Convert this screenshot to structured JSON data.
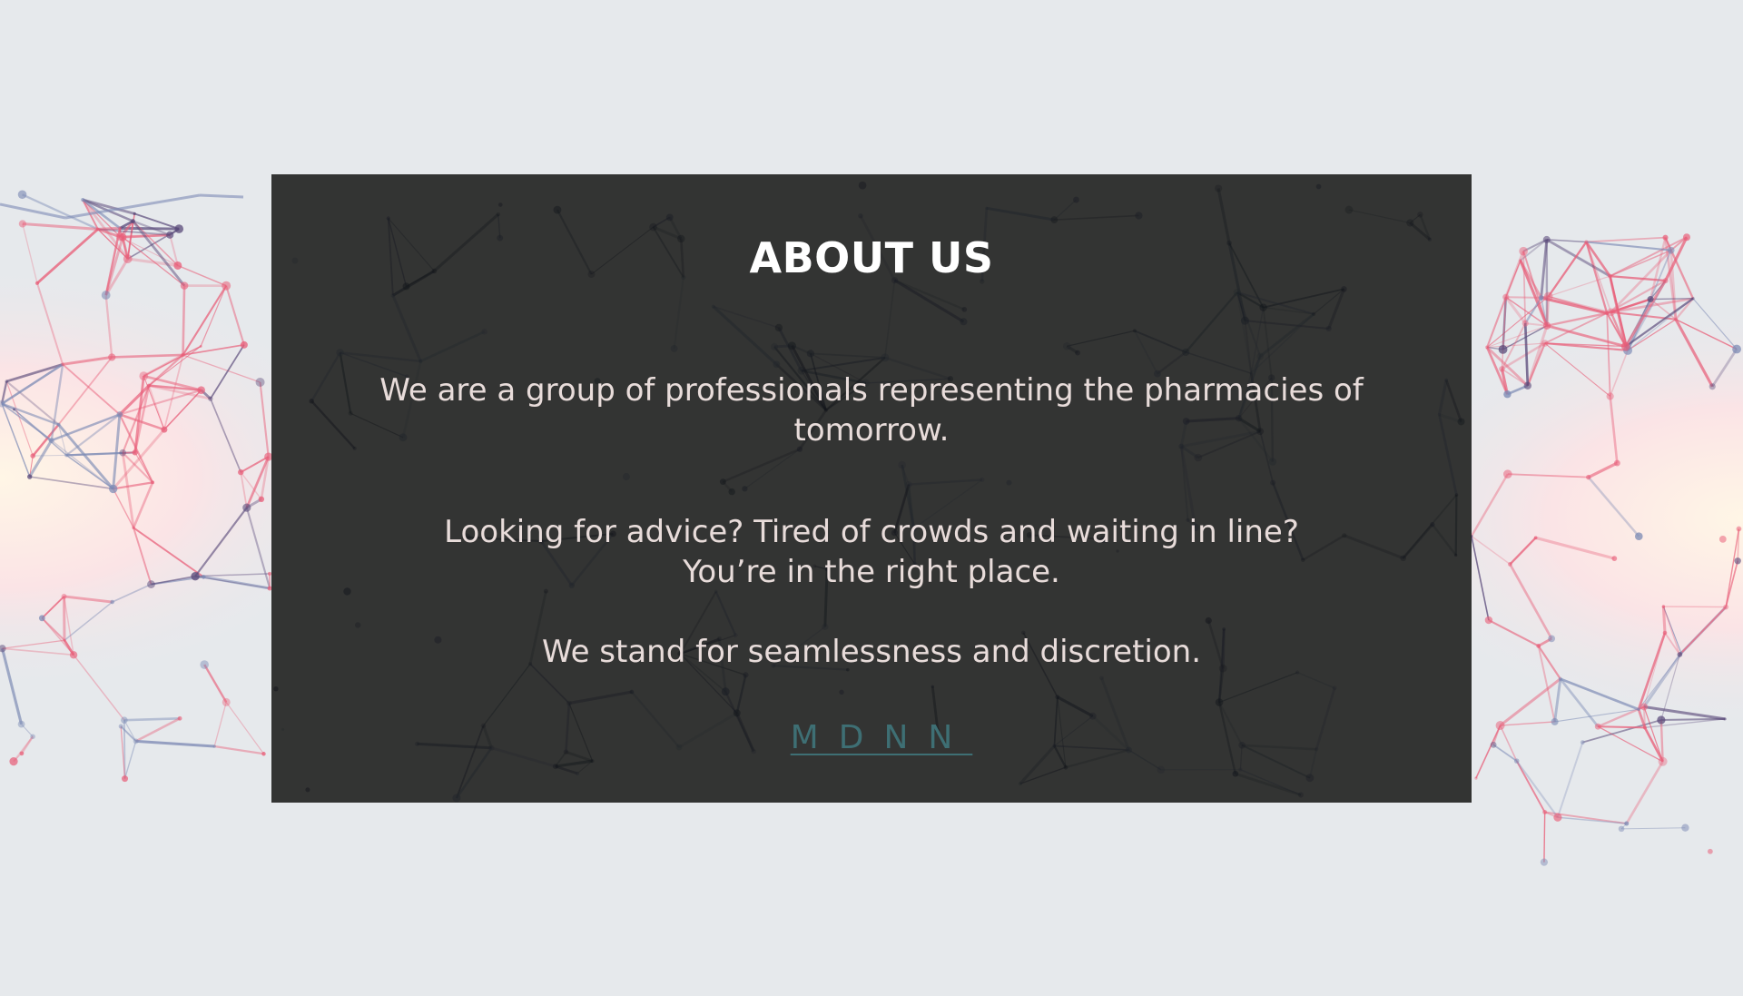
{
  "page": {
    "background_color": "#e6e9ec",
    "card_color": "#2c2d2c"
  },
  "about": {
    "title": "ABOUT US",
    "paragraph_1": "We are a group of professionals representing the pharmacies of tomorrow.",
    "paragraph_2_line_1": "Looking for advice? Tired of crowds and waiting in line?",
    "paragraph_2_line_2": "You’re in the right place.",
    "paragraph_3": "We stand for seamlessness and discretion.",
    "brand_link": "MDNN"
  },
  "colors": {
    "title": "#ffffff",
    "body_text": "#e8dcda",
    "link": "#3e6f74",
    "network_pink": "#e8607a",
    "network_purple": "#5a4a7a",
    "network_blue": "#7d8bb5"
  }
}
